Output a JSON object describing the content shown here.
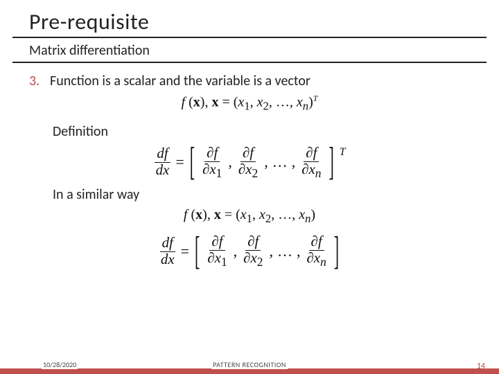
{
  "title": "Pre-requisite",
  "subtitle": "Matrix differentiation",
  "item": {
    "index": "3.",
    "text": "Function is a scalar and the variable is a vector"
  },
  "labels": {
    "definition": "Definition",
    "similar": "In a similar way"
  },
  "math": {
    "fx": "f",
    "x": "x",
    "eq": "=",
    "lp": "(",
    "rp": ")",
    "comma": ",",
    "dots": "…",
    "x1": "x",
    "s1": "1",
    "s2": "2",
    "sn": "n",
    "T": "T",
    "df": "df",
    "dx": "dx",
    "partial": "∂f",
    "px": "∂x"
  },
  "footer": {
    "date": "10/28/2020",
    "center": "PATTERN RECOGNITION",
    "page": "14"
  }
}
